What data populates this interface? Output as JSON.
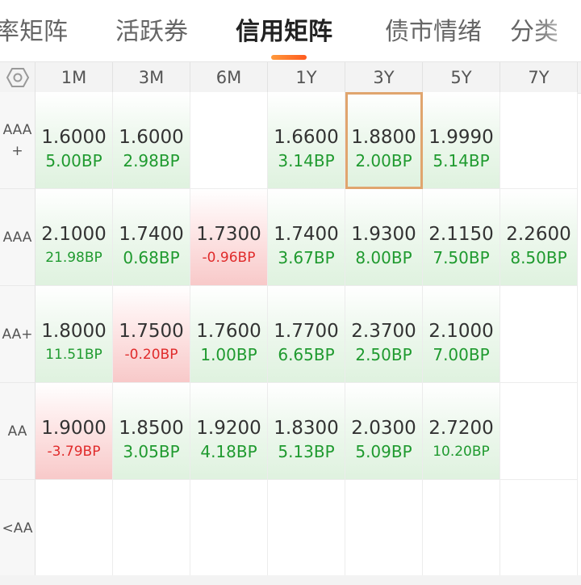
{
  "tabs": [
    {
      "label": "率矩阵",
      "active": false
    },
    {
      "label": "活跃券",
      "active": false
    },
    {
      "label": "信用矩阵",
      "active": true
    },
    {
      "label": "债市情绪",
      "active": false
    },
    {
      "label": "分类",
      "active": false
    }
  ],
  "matrix": {
    "settings_icon": "hexagon-settings-icon",
    "columns": [
      "1M",
      "3M",
      "6M",
      "1Y",
      "3Y",
      "5Y",
      "7Y"
    ],
    "rows": [
      {
        "rating_lines": [
          "AAA",
          "+"
        ],
        "cells": [
          {
            "yield": "1.6000",
            "change": "5.00BP",
            "trend": "up"
          },
          {
            "yield": "1.6000",
            "change": "2.98BP",
            "trend": "up"
          },
          null,
          {
            "yield": "1.6600",
            "change": "3.14BP",
            "trend": "up"
          },
          {
            "yield": "1.8800",
            "change": "2.00BP",
            "trend": "up",
            "selected": true
          },
          {
            "yield": "1.9990",
            "change": "5.14BP",
            "trend": "up"
          },
          null
        ]
      },
      {
        "rating_lines": [
          "AAA"
        ],
        "cells": [
          {
            "yield": "2.1000",
            "change": "21.98BP",
            "trend": "up"
          },
          {
            "yield": "1.7400",
            "change": "0.68BP",
            "trend": "up"
          },
          {
            "yield": "1.7300",
            "change": "-0.96BP",
            "trend": "down"
          },
          {
            "yield": "1.7400",
            "change": "3.67BP",
            "trend": "up"
          },
          {
            "yield": "1.9300",
            "change": "8.00BP",
            "trend": "up"
          },
          {
            "yield": "2.1150",
            "change": "7.50BP",
            "trend": "up"
          },
          {
            "yield": "2.2600",
            "change": "8.50BP",
            "trend": "up"
          }
        ]
      },
      {
        "rating_lines": [
          "AA+"
        ],
        "cells": [
          {
            "yield": "1.8000",
            "change": "11.51BP",
            "trend": "up"
          },
          {
            "yield": "1.7500",
            "change": "-0.20BP",
            "trend": "down"
          },
          {
            "yield": "1.7600",
            "change": "1.00BP",
            "trend": "up"
          },
          {
            "yield": "1.7700",
            "change": "6.65BP",
            "trend": "up"
          },
          {
            "yield": "2.3700",
            "change": "2.50BP",
            "trend": "up"
          },
          {
            "yield": "2.1000",
            "change": "7.00BP",
            "trend": "up"
          },
          null
        ]
      },
      {
        "rating_lines": [
          "AA"
        ],
        "cells": [
          {
            "yield": "1.9000",
            "change": "-3.79BP",
            "trend": "down"
          },
          {
            "yield": "1.8500",
            "change": "3.05BP",
            "trend": "up"
          },
          {
            "yield": "1.9200",
            "change": "4.18BP",
            "trend": "up"
          },
          {
            "yield": "1.8300",
            "change": "5.13BP",
            "trend": "up"
          },
          {
            "yield": "2.0300",
            "change": "5.09BP",
            "trend": "up"
          },
          {
            "yield": "2.7200",
            "change": "10.20BP",
            "trend": "up"
          },
          null
        ]
      },
      {
        "rating_lines": [
          "<AA"
        ],
        "cells": [
          null,
          null,
          null,
          null,
          null,
          null,
          null
        ]
      }
    ]
  },
  "colors": {
    "accent": "#ff6a2a",
    "positive": "#1f9a2f",
    "negative": "#e02b2b",
    "selected_border": "#e0a56e"
  }
}
